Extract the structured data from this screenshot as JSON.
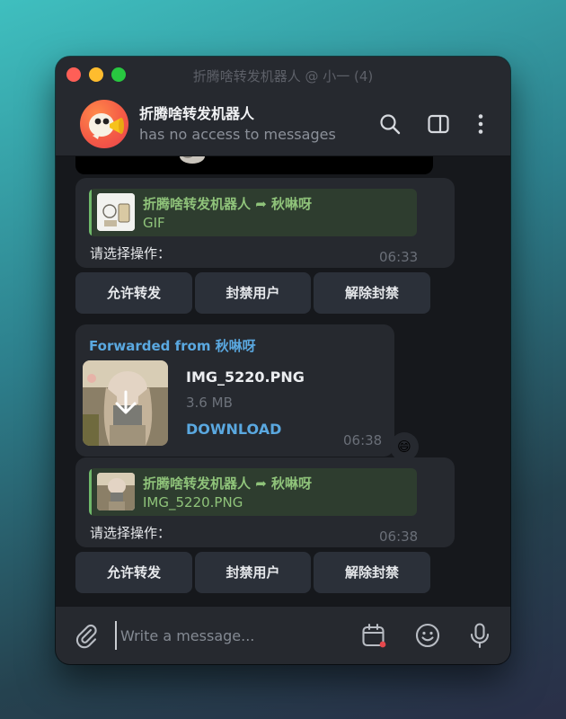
{
  "window": {
    "title": "折腾啥转发机器人 @ 小一 (4)"
  },
  "header": {
    "chat_name": "折腾啥转发机器人",
    "status": "has no access to messages",
    "icons": [
      "search-icon",
      "sidebar-toggle-icon",
      "more-vertical-icon"
    ]
  },
  "messages": [
    {
      "reply": {
        "from": "折腾啥转发机器人 ➦ 秋啉呀",
        "text": "GIF"
      },
      "text": "请选择操作：",
      "time": "06:33",
      "buttons": [
        "允许转发",
        "封禁用户",
        "解除封禁"
      ]
    },
    {
      "forwarded_from": "Forwarded from 秋啉呀",
      "file": {
        "name": "IMG_5220.PNG",
        "size": "3.6 MB",
        "action": "DOWNLOAD"
      },
      "time": "06:38",
      "reaction": "😄"
    },
    {
      "reply": {
        "from": "折腾啥转发机器人 ➦ 秋啉呀",
        "text": "IMG_5220.PNG"
      },
      "text": "请选择操作：",
      "time": "06:38",
      "buttons": [
        "允许转发",
        "封禁用户",
        "解除封禁"
      ]
    }
  ],
  "composer": {
    "placeholder": "Write a message...",
    "icons": [
      "attach-icon",
      "schedule-icon",
      "emoji-icon",
      "microphone-icon"
    ]
  },
  "colors": {
    "accent_link": "#5aa8e0",
    "reply_green": "#8fc37a",
    "bubble_bg": "#26292f",
    "chat_bg": "#16181c"
  }
}
